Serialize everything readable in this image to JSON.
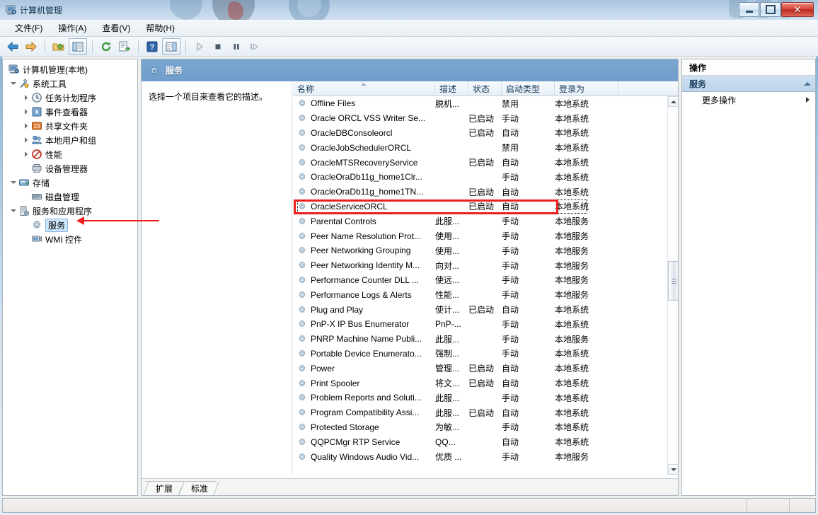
{
  "window": {
    "title": "计算机管理",
    "icon": "computer-management-icon",
    "buttons": {
      "minimize": "最小化",
      "restore": "还原",
      "close": "关闭"
    }
  },
  "menubar": {
    "items": [
      {
        "label": "文件(F)",
        "name": "menu-file"
      },
      {
        "label": "操作(A)",
        "name": "menu-action"
      },
      {
        "label": "查看(V)",
        "name": "menu-view"
      },
      {
        "label": "帮助(H)",
        "name": "menu-help"
      }
    ]
  },
  "toolbar": {
    "buttons": [
      {
        "name": "back-icon",
        "glyph": "back-arrow"
      },
      {
        "name": "forward-icon",
        "glyph": "forward-arrow"
      },
      {
        "name": "up-folder-icon",
        "glyph": "folder-up"
      },
      {
        "name": "show-tree-icon",
        "glyph": "tree-pane"
      },
      {
        "name": "refresh-icon",
        "glyph": "refresh"
      },
      {
        "name": "export-list-icon",
        "glyph": "export"
      },
      {
        "name": "help-icon",
        "glyph": "question"
      },
      {
        "name": "show-action-pane-icon",
        "glyph": "action-pane"
      },
      {
        "name": "start-service-icon",
        "glyph": "play"
      },
      {
        "name": "stop-service-icon",
        "glyph": "stop"
      },
      {
        "name": "pause-service-icon",
        "glyph": "pause"
      },
      {
        "name": "restart-service-icon",
        "glyph": "restart"
      }
    ]
  },
  "tree": {
    "root": {
      "label": "计算机管理(本地)",
      "icon": "computer-icon"
    },
    "nodes": [
      {
        "label": "系统工具",
        "icon": "tools-icon",
        "indent": 1,
        "twisty": "open"
      },
      {
        "label": "任务计划程序",
        "icon": "clock-icon",
        "indent": 2,
        "twisty": "closed"
      },
      {
        "label": "事件查看器",
        "icon": "event-viewer-icon",
        "indent": 2,
        "twisty": "closed"
      },
      {
        "label": "共享文件夹",
        "icon": "shared-folder-icon",
        "indent": 2,
        "twisty": "closed"
      },
      {
        "label": "本地用户和组",
        "icon": "users-icon",
        "indent": 2,
        "twisty": "closed"
      },
      {
        "label": "性能",
        "icon": "performance-icon",
        "indent": 2,
        "twisty": "closed"
      },
      {
        "label": "设备管理器",
        "icon": "device-manager-icon",
        "indent": 2,
        "twisty": "none"
      },
      {
        "label": "存储",
        "icon": "storage-icon",
        "indent": 1,
        "twisty": "open"
      },
      {
        "label": "磁盘管理",
        "icon": "disk-management-icon",
        "indent": 2,
        "twisty": "none"
      },
      {
        "label": "服务和应用程序",
        "icon": "services-apps-icon",
        "indent": 1,
        "twisty": "open"
      },
      {
        "label": "服务",
        "icon": "service-gear-icon",
        "indent": 2,
        "twisty": "none",
        "selected": true
      },
      {
        "label": "WMI 控件",
        "icon": "wmi-icon",
        "indent": 2,
        "twisty": "none"
      }
    ]
  },
  "services_view": {
    "header": {
      "title": "服务",
      "icon": "service-gear-icon"
    },
    "description_pane": {
      "text": "选择一个项目来查看它的描述。"
    },
    "columns": [
      {
        "label": "名称",
        "name": "column-name",
        "sorted": true
      },
      {
        "label": "描述",
        "name": "column-description"
      },
      {
        "label": "状态",
        "name": "column-status"
      },
      {
        "label": "启动类型",
        "name": "column-startup-type"
      },
      {
        "label": "登录为",
        "name": "column-log-on-as"
      }
    ],
    "rows": [
      {
        "name": "Offline Files",
        "description": "脱机...",
        "status": "",
        "startup": "禁用",
        "logon": "本地系统"
      },
      {
        "name": "Oracle ORCL VSS Writer Se...",
        "description": "",
        "status": "已启动",
        "startup": "手动",
        "logon": "本地系统"
      },
      {
        "name": "OracleDBConsoleorcl",
        "description": "",
        "status": "已启动",
        "startup": "自动",
        "logon": "本地系统"
      },
      {
        "name": "OracleJobSchedulerORCL",
        "description": "",
        "status": "",
        "startup": "禁用",
        "logon": "本地系统"
      },
      {
        "name": "OracleMTSRecoveryService",
        "description": "",
        "status": "已启动",
        "startup": "自动",
        "logon": "本地系统"
      },
      {
        "name": "OracleOraDb11g_home1Clr...",
        "description": "",
        "status": "",
        "startup": "手动",
        "logon": "本地系统"
      },
      {
        "name": "OracleOraDb11g_home1TN...",
        "description": "",
        "status": "已启动",
        "startup": "自动",
        "logon": "本地系统"
      },
      {
        "name": "OracleServiceORCL",
        "description": "",
        "status": "已启动",
        "startup": "自动",
        "logon": "本地系统",
        "highlighted": true
      },
      {
        "name": "Parental Controls",
        "description": "此服...",
        "status": "",
        "startup": "手动",
        "logon": "本地服务"
      },
      {
        "name": "Peer Name Resolution Prot...",
        "description": "使用...",
        "status": "",
        "startup": "手动",
        "logon": "本地服务"
      },
      {
        "name": "Peer Networking Grouping",
        "description": "使用...",
        "status": "",
        "startup": "手动",
        "logon": "本地服务"
      },
      {
        "name": "Peer Networking Identity M...",
        "description": "向对...",
        "status": "",
        "startup": "手动",
        "logon": "本地服务"
      },
      {
        "name": "Performance Counter DLL ...",
        "description": "使远...",
        "status": "",
        "startup": "手动",
        "logon": "本地服务"
      },
      {
        "name": "Performance Logs & Alerts",
        "description": "性能...",
        "status": "",
        "startup": "手动",
        "logon": "本地服务"
      },
      {
        "name": "Plug and Play",
        "description": "使计...",
        "status": "已启动",
        "startup": "自动",
        "logon": "本地系统"
      },
      {
        "name": "PnP-X IP Bus Enumerator",
        "description": "PnP-...",
        "status": "",
        "startup": "手动",
        "logon": "本地系统"
      },
      {
        "name": "PNRP Machine Name Publi...",
        "description": "此服...",
        "status": "",
        "startup": "手动",
        "logon": "本地服务"
      },
      {
        "name": "Portable Device Enumerato...",
        "description": "强制...",
        "status": "",
        "startup": "手动",
        "logon": "本地系统"
      },
      {
        "name": "Power",
        "description": "管理...",
        "status": "已启动",
        "startup": "自动",
        "logon": "本地系统"
      },
      {
        "name": "Print Spooler",
        "description": "将文...",
        "status": "已启动",
        "startup": "自动",
        "logon": "本地系统"
      },
      {
        "name": "Problem Reports and Soluti...",
        "description": "此服...",
        "status": "",
        "startup": "手动",
        "logon": "本地系统"
      },
      {
        "name": "Program Compatibility Assi...",
        "description": "此服...",
        "status": "已启动",
        "startup": "自动",
        "logon": "本地系统"
      },
      {
        "name": "Protected Storage",
        "description": "为敏...",
        "status": "",
        "startup": "手动",
        "logon": "本地系统"
      },
      {
        "name": "QQPCMgr RTP Service",
        "description": "QQ...",
        "status": "",
        "startup": "自动",
        "logon": "本地系统"
      },
      {
        "name": "Quality Windows Audio Vid...",
        "description": "优质 ...",
        "status": "",
        "startup": "手动",
        "logon": "本地服务"
      }
    ],
    "tabs": [
      {
        "label": "扩展",
        "name": "tab-extended"
      },
      {
        "label": "标准",
        "name": "tab-standard",
        "active": true
      }
    ]
  },
  "actions_pane": {
    "title": "操作",
    "group": "服务",
    "items": [
      {
        "label": "更多操作",
        "name": "action-more"
      }
    ]
  },
  "annotation": {
    "highlight_color": "#ef1c1c",
    "arrow_target": "服务"
  }
}
